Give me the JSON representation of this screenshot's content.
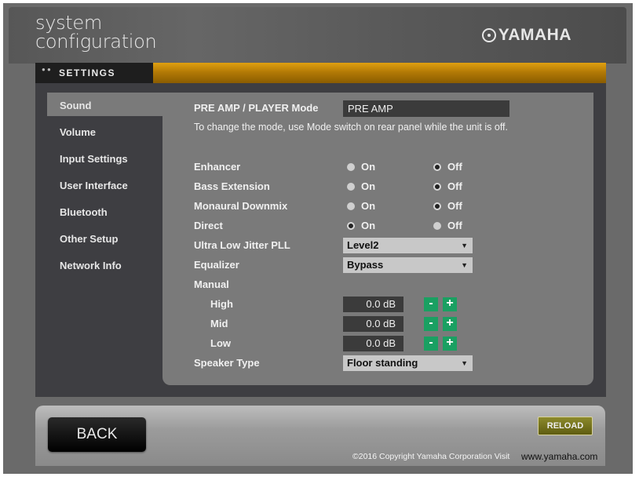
{
  "header": {
    "title_line1": "system",
    "title_line2": "configuration",
    "brand": "YAMAHA",
    "brand_icon": "yamaha-logo-icon"
  },
  "tab": {
    "label": "SETTINGS",
    "color": "#c58a08"
  },
  "sidebar": {
    "items": [
      {
        "label": "Sound"
      },
      {
        "label": "Volume"
      },
      {
        "label": "Input Settings"
      },
      {
        "label": "User Interface"
      },
      {
        "label": "Bluetooth"
      },
      {
        "label": "Other Setup"
      },
      {
        "label": "Network Info"
      }
    ],
    "active": "Sound"
  },
  "settings": {
    "mode_label": "PRE AMP / PLAYER Mode",
    "mode_value": "PRE AMP",
    "mode_note": "To change the mode, use Mode switch on rear panel while the unit is off.",
    "on_label": "On",
    "off_label": "Off",
    "enhancer": {
      "label": "Enhancer",
      "value": "Off"
    },
    "bass_extension": {
      "label": "Bass Extension",
      "value": "Off"
    },
    "monaural_downmix": {
      "label": "Monaural Downmix",
      "value": "Off"
    },
    "direct": {
      "label": "Direct",
      "value": "On"
    },
    "jitter": {
      "label": "Ultra Low Jitter PLL",
      "value": "Level2"
    },
    "equalizer": {
      "label": "Equalizer",
      "value": "Bypass"
    },
    "manual_label": "Manual",
    "high": {
      "label": "High",
      "value": "0.0 dB"
    },
    "mid": {
      "label": "Mid",
      "value": "0.0 dB"
    },
    "low": {
      "label": "Low",
      "value": "0.0 dB"
    },
    "speaker_type": {
      "label": "Speaker Type",
      "value": "Floor standing"
    },
    "minus": "-",
    "plus": "+",
    "stepper_color": "#1aa062"
  },
  "footer": {
    "back_label": "BACK",
    "reload_label": "RELOAD",
    "copyright": "©2016 Copyright Yamaha Corporation Visit",
    "link": "www.yamaha.com"
  }
}
